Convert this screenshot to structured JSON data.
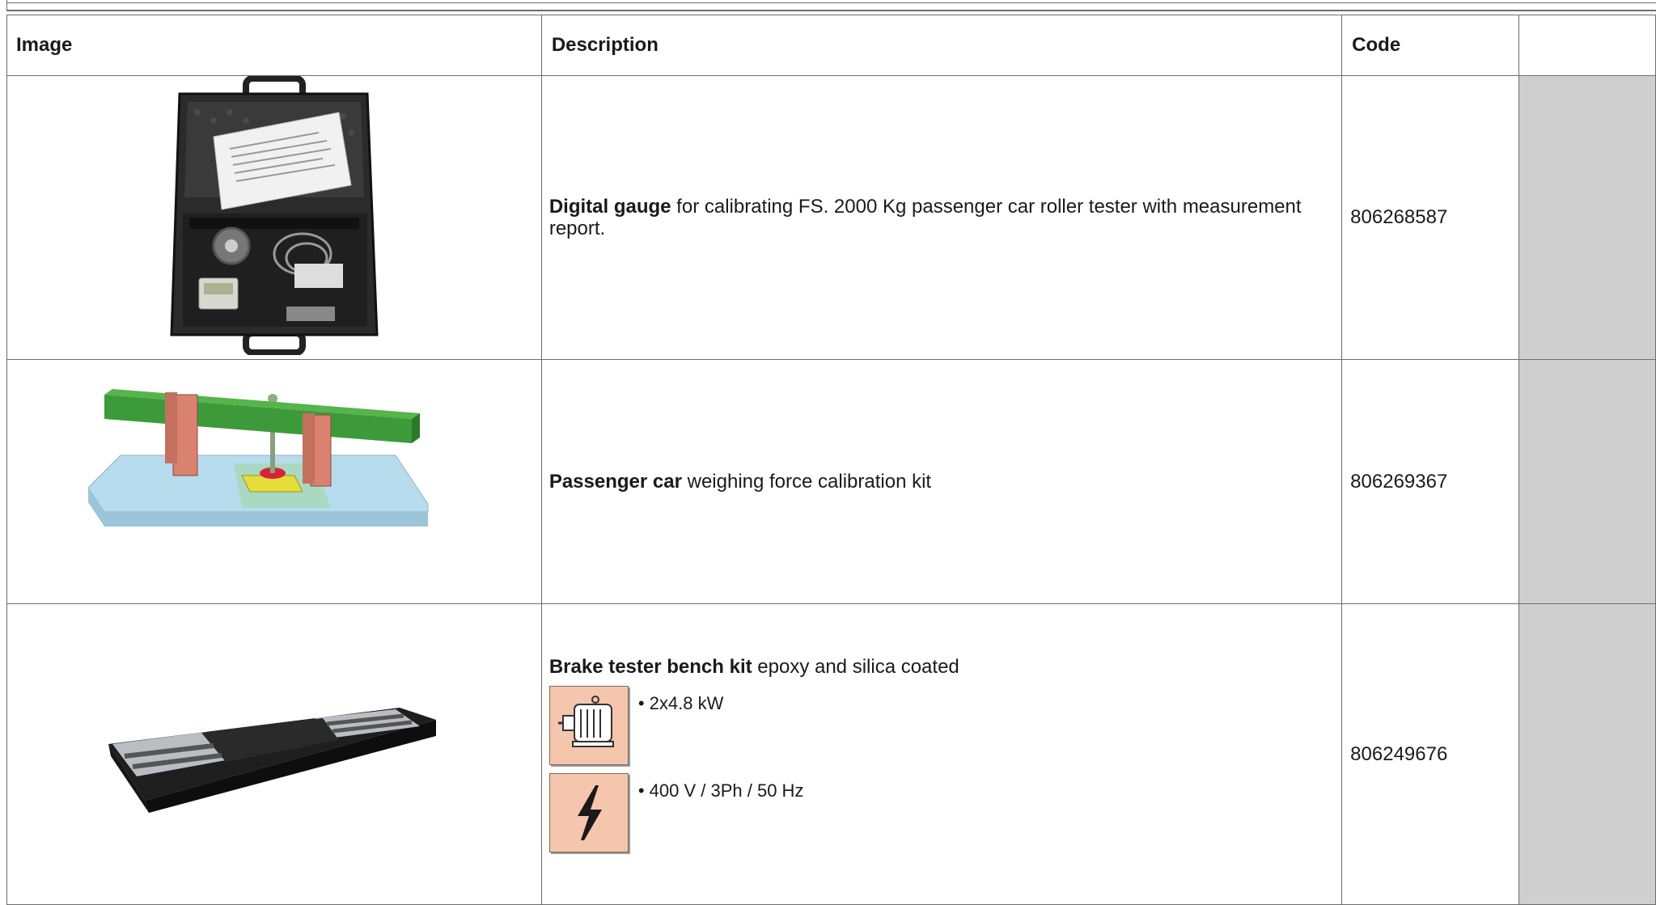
{
  "table": {
    "headers": {
      "image": "Image",
      "description": "Description",
      "code": "Code",
      "extra": ""
    },
    "rows": [
      {
        "image_icon": "gauge-case-photo",
        "name_bold": "Digital gauge",
        "name_rest": " for calibrating FS. 2000 Kg passenger car roller tester with measurement report.",
        "code": "806268587"
      },
      {
        "image_icon": "calibration-kit-drawing",
        "name_bold": "Passenger car",
        "name_rest": " weighing force calibration kit",
        "code": "806269367"
      },
      {
        "image_icon": "brake-tester-bench-photo",
        "name_bold": "Brake tester bench kit",
        "name_rest": " epoxy  and silica coated",
        "specs": [
          {
            "icon": "motor-icon",
            "text": "• 2x4.8 kW"
          },
          {
            "icon": "voltage-icon",
            "text": "• 400 V / 3Ph / 50 Hz"
          }
        ],
        "code": "806249676"
      }
    ]
  },
  "colors": {
    "border": "#6d6d6d",
    "gray_cell": "#cfcfcf",
    "icon_bg": "#f5c5ad"
  }
}
